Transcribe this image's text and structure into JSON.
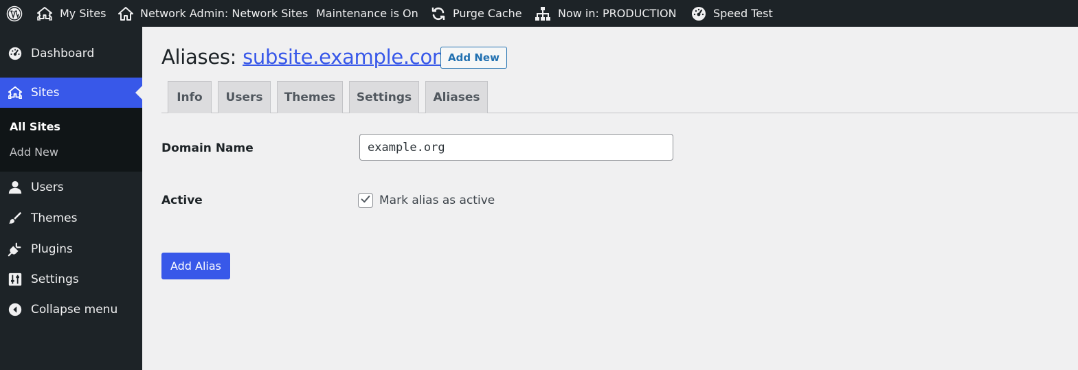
{
  "admin_bar": {
    "items": [
      {
        "label": "",
        "icon": "wordpress-logo-icon"
      },
      {
        "label": "My Sites",
        "icon": "my-sites-icon"
      },
      {
        "label": "Network Admin: Network Sites",
        "icon": "home-icon"
      },
      {
        "label": "Maintenance is On",
        "icon": ""
      },
      {
        "label": "Purge Cache",
        "icon": "refresh-icon"
      },
      {
        "label": "Now in: PRODUCTION",
        "icon": "sitemap-icon"
      },
      {
        "label": "Speed Test",
        "icon": "dashboard-gauge-icon"
      }
    ]
  },
  "sidebar": {
    "items": [
      {
        "label": "Dashboard",
        "icon": "dashboard-gauge-icon"
      },
      {
        "label": "Sites",
        "icon": "my-sites-icon",
        "current": true
      },
      {
        "label": "Users",
        "icon": "users-icon"
      },
      {
        "label": "Themes",
        "icon": "brush-icon"
      },
      {
        "label": "Plugins",
        "icon": "plugins-icon"
      },
      {
        "label": "Settings",
        "icon": "settings-sliders-icon"
      },
      {
        "label": "Collapse menu",
        "icon": "collapse-arrow-icon"
      }
    ],
    "submenu": [
      {
        "label": "All Sites",
        "current": true
      },
      {
        "label": "Add New"
      }
    ]
  },
  "page": {
    "title_prefix": "Aliases:",
    "site_link": "subsite.example.com",
    "add_new_label": "Add New",
    "tabs": [
      {
        "label": "Info"
      },
      {
        "label": "Users"
      },
      {
        "label": "Themes"
      },
      {
        "label": "Settings"
      },
      {
        "label": "Aliases"
      }
    ]
  },
  "form": {
    "domain_label": "Domain Name",
    "domain_value": "example.org",
    "active_label": "Active",
    "active_checkbox_label": "Mark alias as active",
    "active_checked": true,
    "submit_label": "Add Alias"
  },
  "colors": {
    "accent": "#3858e9",
    "admin_bar_bg": "#1d2327",
    "page_bg": "#f0f0f1"
  }
}
